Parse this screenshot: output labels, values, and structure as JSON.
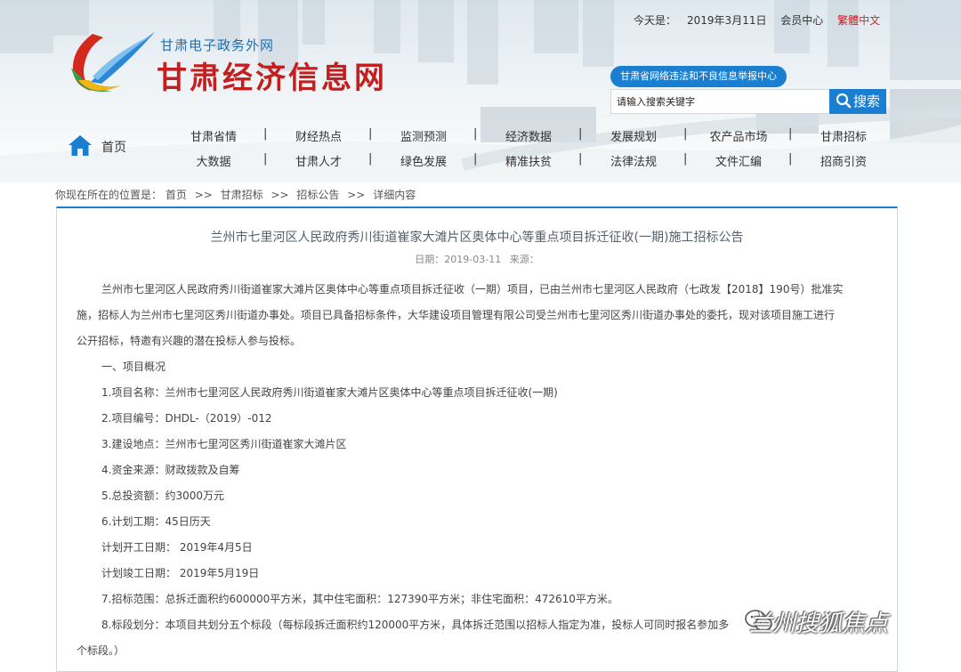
{
  "top": {
    "date_prefix": "今天是：",
    "date": "2019年3月11日",
    "member_center": "会员中心",
    "lang_traditional": "繁體",
    "lang_simplified": "中文"
  },
  "logo": {
    "subtitle": "甘肃电子政务外网",
    "title": "甘肃经济信息网"
  },
  "report_button": "甘肃省网络违法和不良信息举报中心",
  "search": {
    "placeholder": "请输入搜索关键字",
    "button_label": "搜索"
  },
  "nav": {
    "home": "首页",
    "row1": [
      "甘肃省情",
      "财经热点",
      "监测预测",
      "经济数据",
      "发展规划",
      "农产品市场",
      "甘肃招标"
    ],
    "row2": [
      "大数据",
      "甘肃人才",
      "绿色发展",
      "精准扶贫",
      "法律法规",
      "文件汇编",
      "招商引资"
    ],
    "separator": "|"
  },
  "breadcrumb": {
    "prefix": "你现在所在的位置是：",
    "items": [
      "首页",
      "甘肃招标",
      "招标公告",
      "详细内容"
    ],
    "separator": ">>"
  },
  "article": {
    "title": "兰州市七里河区人民政府秀川街道崔家大滩片区奥体中心等重点项目拆迁征收(一期)施工招标公告",
    "date_label": "日期：",
    "date": "2019-03-11",
    "source_label": "来源：",
    "paragraphs": [
      "兰州市七里河区人民政府秀川街道崔家大滩片区奥体中心等重点项目拆迁征收（一期）项目，已由兰州市七里河区人民政府（七政发【2018】190号）批准实",
      "施，招标人为兰州市七里河区秀川街道办事处。项目已具备招标条件，大华建设项目管理有限公司受兰州市七里河区秀川街道办事处的委托，现对该项目施工进行",
      "公开招标，特邀有兴趣的潜在投标人参与投标。",
      "一、项目概况",
      "1.项目名称：兰州市七里河区人民政府秀川街道崔家大滩片区奥体中心等重点项目拆迁征收(一期)",
      "2.项目编号：DHDL-（2019）-012",
      "3.建设地点：兰州市七里河区秀川街道崔家大滩片区",
      "4.资金来源：财政拨款及自筹",
      "5.总投资额：约3000万元",
      "6.计划工期：45日历天",
      "计划开工日期： 2019年4月5日",
      "计划竣工日期： 2019年5月19日",
      "7.招标范围：总拆迁面积约600000平方米，其中住宅面积：127390平方米；非住宅面积：472610平方米。",
      "8.标段划分：本项目共划分五个标段（每标段拆迁面积约120000平方米，具体拆迁范围以招标人指定为准，投标人可同时报名参加多",
      "个标段。）"
    ]
  },
  "watermark": "兰州搜狐焦点",
  "colors": {
    "brand_blue": "#1a7fd1",
    "logo_red": "#c41f1f",
    "date_red": "#d01818"
  }
}
